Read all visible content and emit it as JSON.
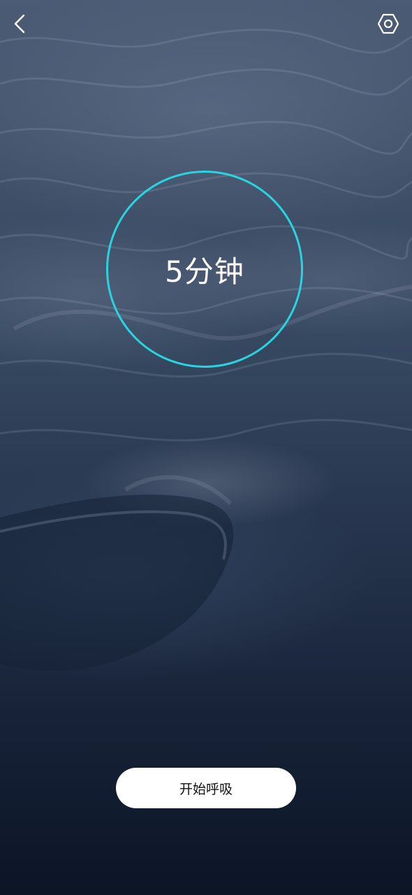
{
  "header": {
    "back_icon": "chevron-left-icon",
    "settings_icon": "hexagon-settings-icon"
  },
  "timer": {
    "label": "5分钟",
    "ring_color": "#2ad3e0"
  },
  "actions": {
    "start_label": "开始呼吸"
  }
}
